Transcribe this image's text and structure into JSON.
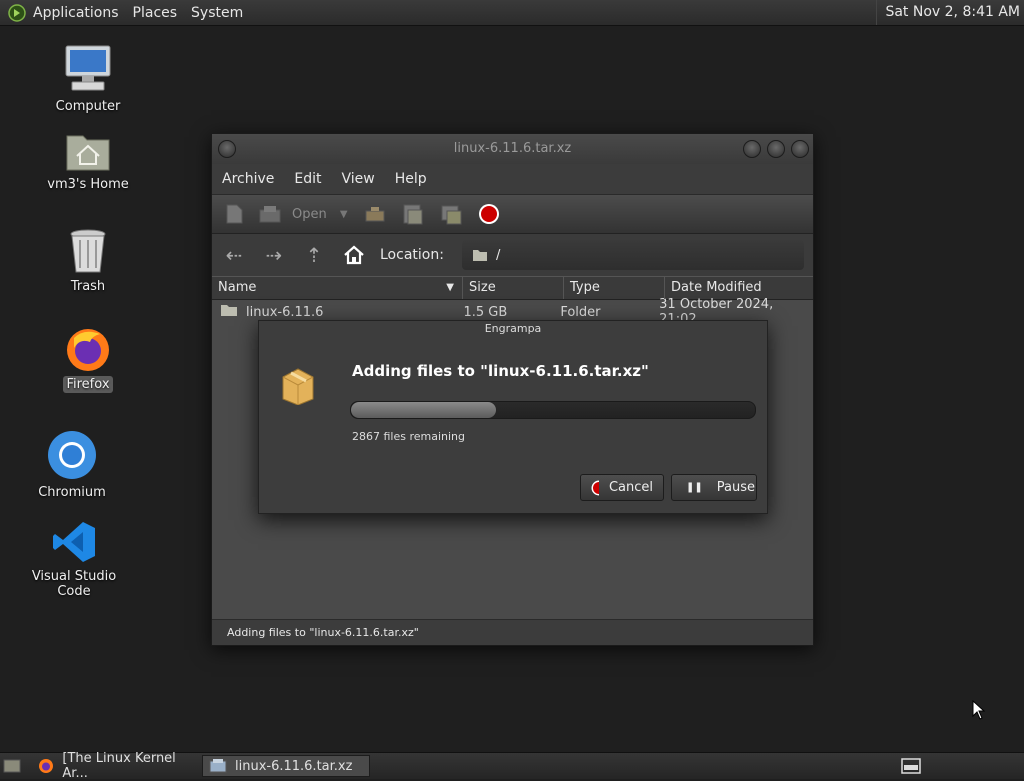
{
  "top_panel": {
    "menus": [
      "Applications",
      "Places",
      "System"
    ],
    "clock": "Sat Nov 2, 8:41 AM"
  },
  "desktop": {
    "icons": [
      {
        "label": "Computer",
        "icon": "computer-icon"
      },
      {
        "label": "vm3's Home",
        "icon": "home-folder-icon"
      },
      {
        "label": "Trash",
        "icon": "trash-icon"
      },
      {
        "label": "Firefox",
        "icon": "firefox-icon"
      },
      {
        "label": "Chromium",
        "icon": "chromium-icon"
      },
      {
        "label": "Visual Studio Code",
        "icon": "vscode-icon"
      }
    ]
  },
  "window": {
    "title": "linux-6.11.6.tar.xz",
    "menu": [
      "Archive",
      "Edit",
      "View",
      "Help"
    ],
    "toolbar": {
      "open_label": "Open"
    },
    "location": {
      "label": "Location:",
      "path": "/"
    },
    "columns": [
      "Name",
      "Size",
      "Type",
      "Date Modified"
    ],
    "rows": [
      {
        "name": "linux-6.11.6",
        "size": "1.5 GB",
        "type": "Folder",
        "modified": "31 October 2024, 21:02"
      }
    ],
    "status": "Adding files to \"linux-6.11.6.tar.xz\""
  },
  "dialog": {
    "title": "Engrampa",
    "heading": "Adding files to \"linux-6.11.6.tar.xz\"",
    "progress_fraction": 0.36,
    "remaining": "2867 files remaining",
    "cancel_label": "Cancel",
    "pause_label": "Pause"
  },
  "taskbar": {
    "tasks": [
      {
        "label": "[The Linux Kernel Ar...",
        "icon": "firefox-icon"
      },
      {
        "label": "linux-6.11.6.tar.xz",
        "icon": "archive-manager-icon"
      }
    ]
  },
  "colors": {
    "accent_red": "#cc0000",
    "vscode_blue": "#1e88e5",
    "chromium_blue": "#3b8fe0"
  }
}
